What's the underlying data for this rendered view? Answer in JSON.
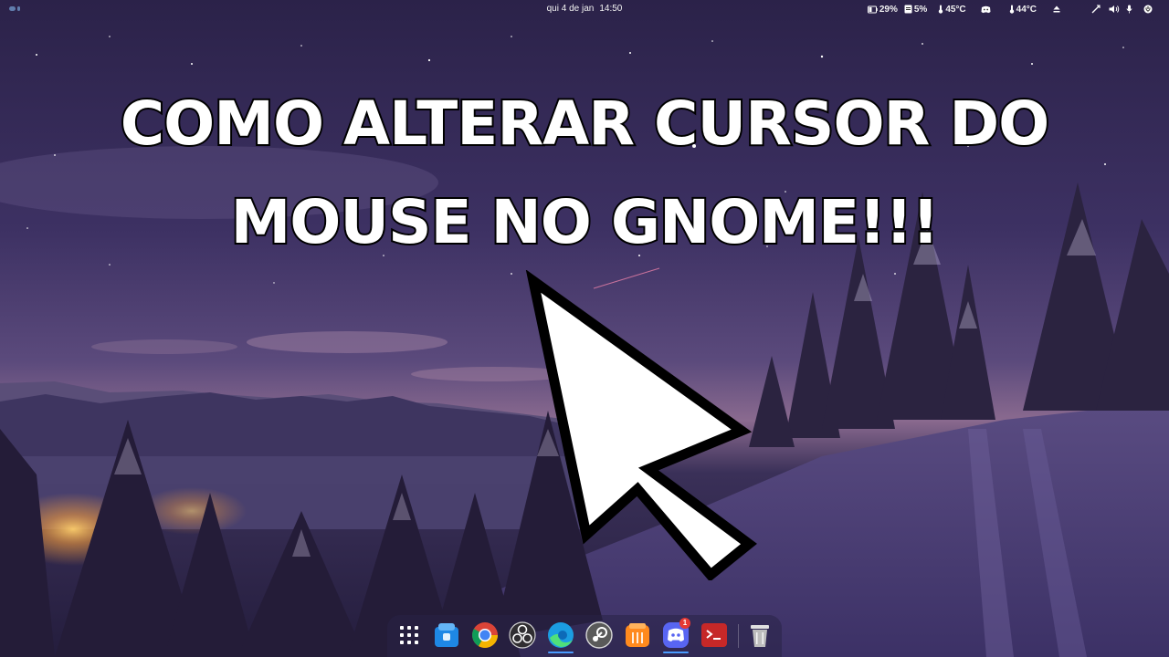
{
  "topbar": {
    "clock": {
      "date": "qui 4 de jan",
      "time": "14:50"
    },
    "indicators": {
      "battery": "29%",
      "cpu": "5%",
      "temp_cpu": "45°C",
      "temp_gpu": "44°C"
    }
  },
  "headline": {
    "line1": "COMO ALTERAR CURSOR DO",
    "line2": "MOUSE NO GNOME!!!"
  },
  "dock": {
    "items": [
      {
        "icon": "app-grid-icon",
        "running": false
      },
      {
        "icon": "software-store-icon",
        "running": false
      },
      {
        "icon": "chrome-icon",
        "running": false
      },
      {
        "icon": "obs-studio-icon",
        "running": false
      },
      {
        "icon": "edge-browser-icon",
        "running": true
      },
      {
        "icon": "steam-icon",
        "running": false
      },
      {
        "icon": "sublime-text-icon",
        "running": false
      },
      {
        "icon": "discord-icon",
        "running": true,
        "badge": "1"
      },
      {
        "icon": "terminal-icon",
        "running": false
      },
      {
        "icon": "trash-icon",
        "running": false
      }
    ]
  },
  "colors": {
    "sky_top": "#352a57",
    "sky_mid": "#4f3f73",
    "horizon_glow": "#8a6a8f",
    "snow": "#4b3f72",
    "accent_running": "#4a9cff",
    "badge": "#e53935"
  }
}
